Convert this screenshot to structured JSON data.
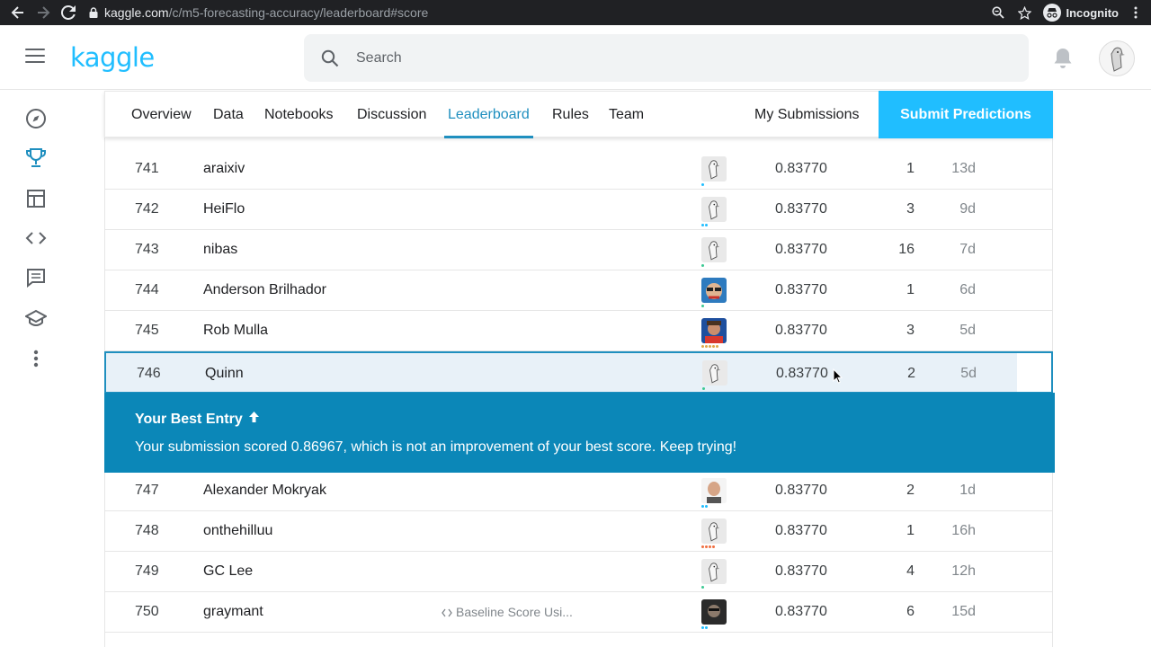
{
  "browser": {
    "url_host": "kaggle.com",
    "url_path": "/c/m5-forecasting-accuracy/leaderboard#score",
    "incognito_label": "Incognito"
  },
  "header": {
    "logo": "kaggle",
    "search_placeholder": "Search"
  },
  "rail": {
    "items": [
      "compass-icon",
      "trophy-icon",
      "table-icon",
      "code-icon",
      "comment-icon",
      "school-icon",
      "more-icon"
    ]
  },
  "tabs": {
    "items": [
      {
        "label": "Overview",
        "active": false
      },
      {
        "label": "Data",
        "active": false
      },
      {
        "label": "Notebooks",
        "active": false
      },
      {
        "label": "Discussion",
        "active": false
      },
      {
        "label": "Leaderboard",
        "active": true
      },
      {
        "label": "Rules",
        "active": false
      },
      {
        "label": "Team",
        "active": false
      }
    ],
    "my_submissions": "My Submissions",
    "submit": "Submit Predictions"
  },
  "rows_before": [
    {
      "rank": "741",
      "name": "araixiv",
      "kernel": "",
      "avatar": "default",
      "tier": [
        "#20beff"
      ],
      "score": "0.83770",
      "entries": "1",
      "last": "13d"
    },
    {
      "rank": "742",
      "name": "HeiFlo",
      "kernel": "",
      "avatar": "default",
      "tier": [
        "#20beff",
        "#20beff"
      ],
      "score": "0.83770",
      "entries": "3",
      "last": "9d"
    },
    {
      "rank": "743",
      "name": "nibas",
      "kernel": "",
      "avatar": "default",
      "tier": [
        "#3cc993"
      ],
      "score": "0.83770",
      "entries": "16",
      "last": "7d"
    },
    {
      "rank": "744",
      "name": "Anderson Brilhador",
      "kernel": "",
      "avatar": "photo-glasses",
      "tier": [
        "#3cc993"
      ],
      "score": "0.83770",
      "entries": "1",
      "last": "6d"
    },
    {
      "rank": "745",
      "name": "Rob Mulla",
      "kernel": "",
      "avatar": "photo-red",
      "tier": [
        "#e0a94a",
        "#e0a94a",
        "#e0a94a",
        "#e0a94a",
        "#e0a94a"
      ],
      "score": "0.83770",
      "entries": "3",
      "last": "5d"
    }
  ],
  "my_row": {
    "rank": "746",
    "name": "Quinn",
    "kernel": "",
    "avatar": "default",
    "tier": [
      "#3cc993"
    ],
    "score": "0.83770",
    "entries": "2",
    "last": "5d"
  },
  "banner": {
    "title": "Your Best Entry",
    "message": "Your submission scored 0.86967, which is not an improvement of your best score. Keep trying!"
  },
  "rows_after": [
    {
      "rank": "747",
      "name": "Alexander Mokryak",
      "kernel": "",
      "avatar": "photo-face",
      "tier": [
        "#20beff",
        "#20beff"
      ],
      "score": "0.83770",
      "entries": "2",
      "last": "1d"
    },
    {
      "rank": "748",
      "name": "onthehilluu",
      "kernel": "",
      "avatar": "default",
      "tier": [
        "#f06f41",
        "#f06f41",
        "#f06f41",
        "#f06f41"
      ],
      "score": "0.83770",
      "entries": "1",
      "last": "16h"
    },
    {
      "rank": "749",
      "name": "GC Lee",
      "kernel": "",
      "avatar": "default",
      "tier": [
        "#3cc993"
      ],
      "score": "0.83770",
      "entries": "4",
      "last": "12h"
    },
    {
      "rank": "750",
      "name": "graymant",
      "kernel": "Baseline Score Usi...",
      "avatar": "photo-dark",
      "tier": [
        "#20beff",
        "#20beff"
      ],
      "score": "0.83770",
      "entries": "6",
      "last": "15d"
    }
  ],
  "colors": {
    "accent": "#20beff",
    "tab_active": "#1f8fbf",
    "banner": "#0b87b8",
    "highlight_row": "#e8f1f8"
  }
}
